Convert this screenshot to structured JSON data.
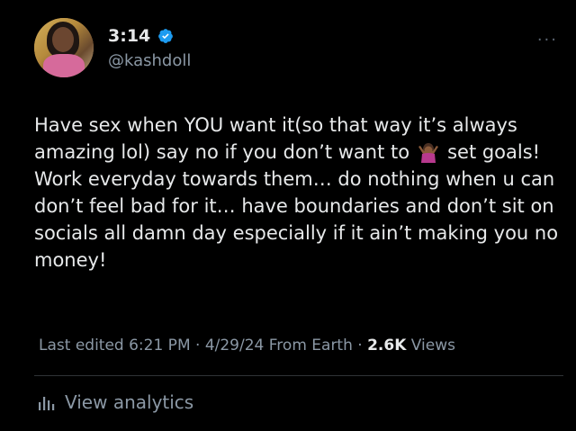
{
  "tweet": {
    "author_time": "3:14",
    "handle": "@kashdoll",
    "more_label": "···",
    "text_part1": "Have sex when YOU want it(so that way it’s always amazing lol) say no if you don’t want to",
    "emoji_name": "person-shrugging-emoji",
    "text_part2": "set goals! Work everyday towards them… do nothing when u can don’t feel bad for it… have boundaries and don’t sit on socials all damn day especially if it ain’t making you no money!",
    "meta_edited": "Last edited 6:21 PM · 4/29/24",
    "meta_source": "From Earth ·",
    "views_count": "2.6K",
    "views_label": "Views",
    "analytics_label": "View analytics"
  },
  "colors": {
    "background": "#000000",
    "text": "#e7e9ea",
    "secondary": "#8b98a5",
    "verified": "#1d9bf0",
    "divider": "#2f3336"
  },
  "icons": [
    "verified-badge-icon",
    "more-options-icon",
    "analytics-bars-icon"
  ]
}
